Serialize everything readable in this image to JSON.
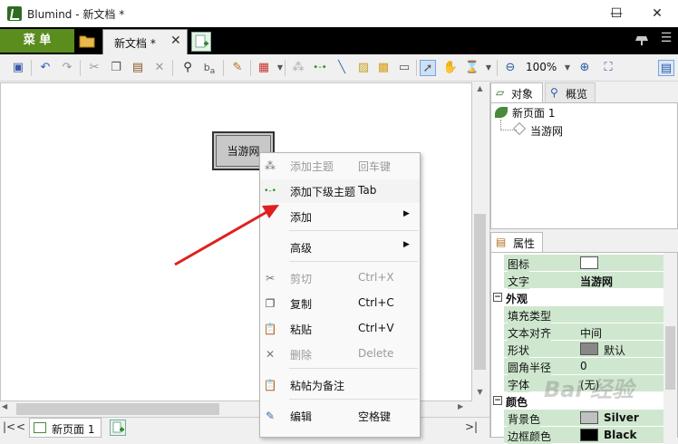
{
  "window": {
    "title": "Blumind - 新文档 *",
    "minimize": "—",
    "maximize": "☐",
    "close": "✕"
  },
  "tabbar": {
    "menu_label": "菜 单",
    "doc_tab_label": "新文档 *",
    "doc_tab_close": "✕"
  },
  "toolbar": {
    "zoom": "100%"
  },
  "canvas": {
    "node_label": "当游网"
  },
  "bottombar": {
    "page_tab": "新页面 1",
    "nav_first": "|<",
    "nav_prev": "<",
    "nav_next": ">|"
  },
  "sidepanel": {
    "tabs": {
      "objects": "对象",
      "overview": "概览",
      "properties": "属性"
    },
    "tree": {
      "root": "新页面 1",
      "child": "当游网"
    },
    "properties": [
      {
        "name": "图标",
        "value": "",
        "kind": "row",
        "green": true,
        "swatch": "#ffffff"
      },
      {
        "name": "文字",
        "value": "当游网",
        "kind": "row",
        "green": true,
        "bold": true
      },
      {
        "name": "外观",
        "kind": "category"
      },
      {
        "name": "填充类型",
        "value": "",
        "kind": "row",
        "green": true
      },
      {
        "name": "文本对齐",
        "value": "中间",
        "kind": "row",
        "green": true
      },
      {
        "name": "形状",
        "value": "默认",
        "kind": "row",
        "green": true,
        "swatch": "#888888"
      },
      {
        "name": "圆角半径",
        "value": "0",
        "kind": "row",
        "green": true
      },
      {
        "name": "字体",
        "value": "(无)",
        "kind": "row",
        "green": true
      },
      {
        "name": "颜色",
        "kind": "category"
      },
      {
        "name": "背景色",
        "value": "Silver",
        "kind": "row",
        "green": true,
        "bold": true,
        "swatch": "#c0c0c0"
      },
      {
        "name": "边框颜色",
        "value": "Black",
        "kind": "row",
        "green": true,
        "bold": true,
        "swatch": "#000000"
      }
    ]
  },
  "context_menu": {
    "items": [
      {
        "label": "添加主题",
        "key": "回车键",
        "disabled": true,
        "icon": "add-topic-icon",
        "glyph": "⁂"
      },
      {
        "label": "添加下级主题",
        "key": "Tab",
        "disabled": false,
        "icon": "add-subtopic-icon",
        "glyph": "•-•"
      },
      {
        "label": "添加",
        "key": "",
        "disabled": false,
        "submenu": true
      },
      {
        "label": "高级",
        "key": "",
        "disabled": false,
        "submenu": true
      },
      {
        "label": "剪切",
        "key": "Ctrl+X",
        "disabled": true,
        "icon": "cut-icon",
        "glyph": "✂"
      },
      {
        "label": "复制",
        "key": "Ctrl+C",
        "disabled": false,
        "icon": "copy-icon",
        "glyph": "❐"
      },
      {
        "label": "粘贴",
        "key": "Ctrl+V",
        "disabled": false,
        "icon": "paste-icon",
        "glyph": "📋"
      },
      {
        "label": "删除",
        "key": "Delete",
        "disabled": true,
        "icon": "delete-icon",
        "glyph": "✕"
      },
      {
        "label": "粘帖为备注",
        "key": "",
        "disabled": false,
        "icon": "paste-note-icon",
        "glyph": "📋"
      },
      {
        "label": "编辑",
        "key": "空格键",
        "disabled": false,
        "icon": "edit-icon",
        "glyph": "✎"
      }
    ]
  },
  "watermark": "Bai 经验",
  "colors": {
    "menu_green": "#5a8c1e",
    "prop_green": "#cfe7cf",
    "annotation_red": "#e02020"
  }
}
